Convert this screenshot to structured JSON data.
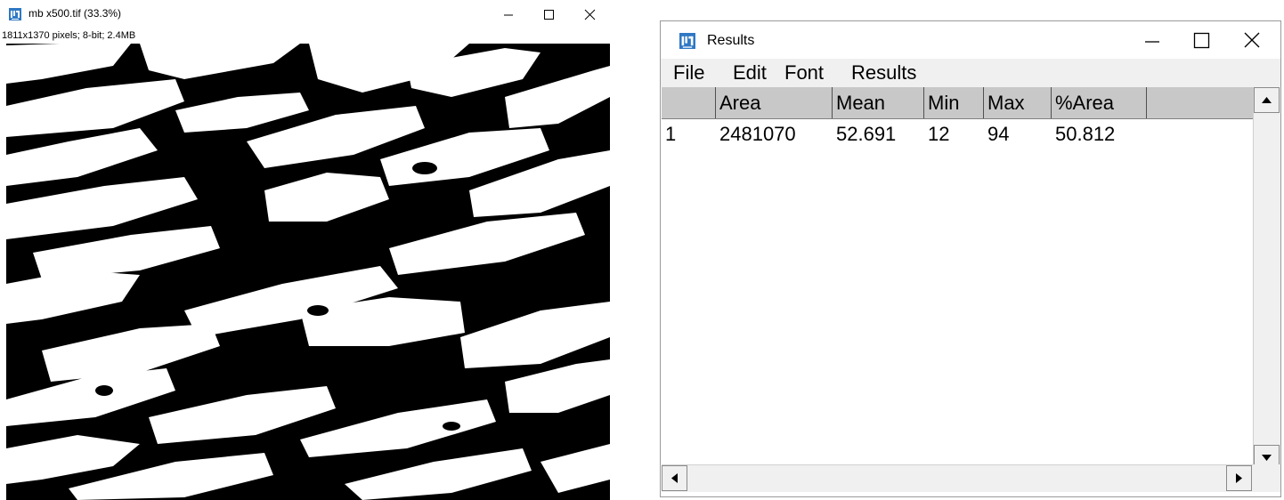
{
  "image_window": {
    "title": "mb x500.tif (33.3%)",
    "info": "1811x1370 pixels; 8-bit; 2.4MB",
    "controls": {
      "minimize_icon": "minimize-icon",
      "maximize_icon": "maximize-icon",
      "close_icon": "close-icon"
    },
    "image_description_icon": "binary-image"
  },
  "results_window": {
    "title": "Results",
    "menu": [
      "File",
      "Edit",
      "Font",
      "Results"
    ],
    "columns": [
      "",
      "Area",
      "Mean",
      "Min",
      "Max",
      "%Area"
    ],
    "rows": [
      [
        "1",
        "2481070",
        "52.691",
        "12",
        "94",
        "50.812"
      ]
    ],
    "colors": {
      "header_bg": "#c8c8c8",
      "menubar_bg": "#f0f0f0",
      "app_icon": "#2f78c4"
    }
  }
}
